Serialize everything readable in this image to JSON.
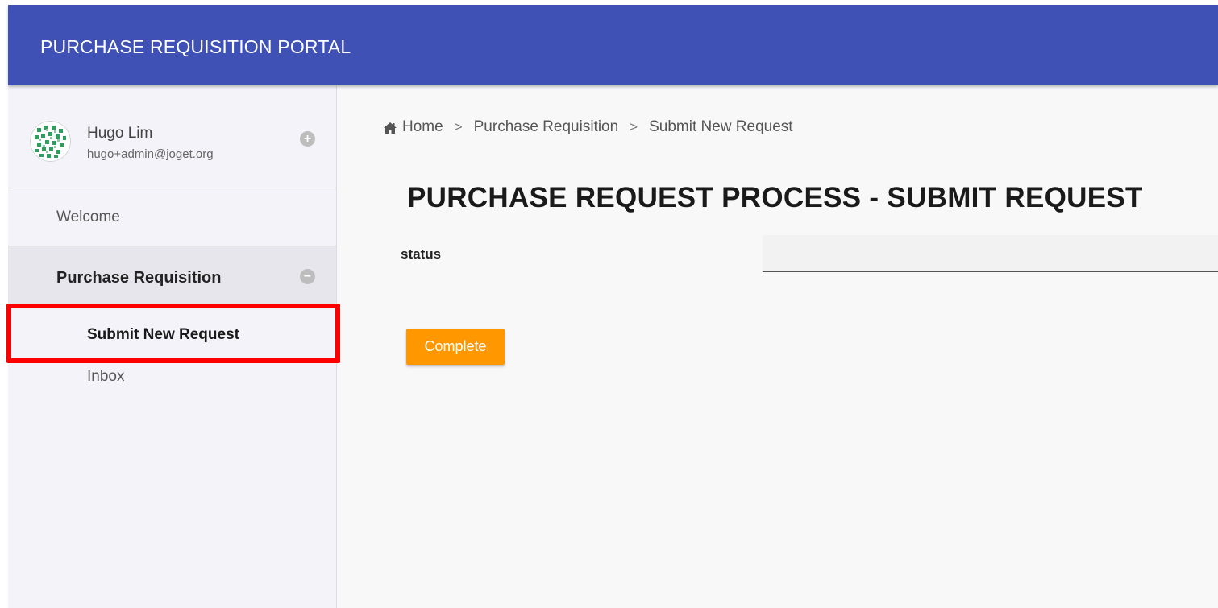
{
  "app": {
    "title": "PURCHASE REQUISITION PORTAL"
  },
  "user": {
    "name": "Hugo Lim",
    "email": "hugo+admin@joget.org",
    "expand_icon": "plus-circle-icon"
  },
  "sidebar": {
    "welcome": "Welcome",
    "purchase_requisition": {
      "label": "Purchase Requisition",
      "collapse_icon": "minus-circle-icon"
    },
    "submenu": [
      {
        "label": "Submit New Request",
        "active": true
      },
      {
        "label": "Inbox",
        "active": false
      }
    ]
  },
  "breadcrumb": {
    "home_icon": "home-icon",
    "items": [
      "Home",
      "Purchase Requisition",
      "Submit New Request"
    ],
    "separator": ">"
  },
  "form": {
    "title": "PURCHASE REQUEST PROCESS - SUBMIT REQUEST",
    "status_label": "status",
    "status_value": "",
    "submit_label": "Complete"
  },
  "colors": {
    "header": "#3f51b5",
    "button": "#ff9800",
    "highlight": "#ff0000"
  }
}
